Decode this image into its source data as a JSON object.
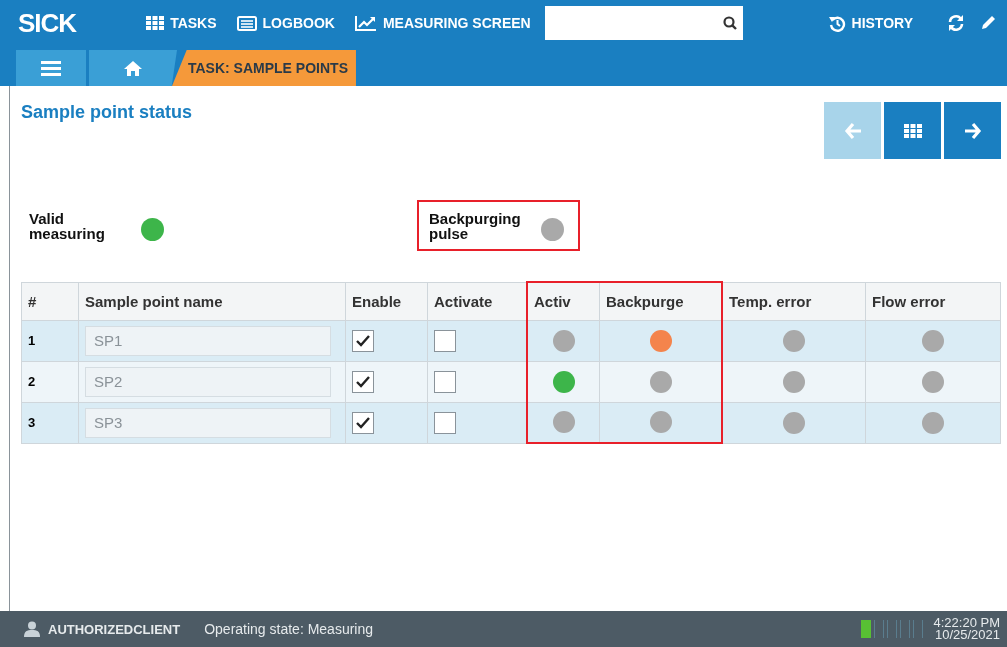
{
  "topbar": {
    "logo": "SICK",
    "nav": [
      {
        "kind": "grid",
        "label": "TASKS"
      },
      {
        "kind": "book",
        "label": "LOGBOOK"
      },
      {
        "kind": "chart",
        "label": "MEASURING SCREEN"
      }
    ],
    "history": "HISTORY"
  },
  "breadcrumb": {
    "task": "TASK: SAMPLE POINTS"
  },
  "page": {
    "title": "Sample point status",
    "pager": [
      {
        "kind": "prev",
        "disabled": true
      },
      {
        "kind": "grid",
        "disabled": false
      },
      {
        "kind": "next",
        "disabled": false
      }
    ]
  },
  "indicators": [
    {
      "label": "Valid measuring",
      "color": "#3db54a",
      "highlighted": false
    },
    {
      "label": "Backpurging pulse",
      "color": "#a9a9a9",
      "highlighted": true
    }
  ],
  "table": {
    "columns": [
      {
        "label": "#",
        "highlighted": false
      },
      {
        "label": "Sample point name",
        "highlighted": false
      },
      {
        "label": "Enable",
        "highlighted": false
      },
      {
        "label": "Activate",
        "highlighted": false
      },
      {
        "label": "Activ",
        "highlighted": true
      },
      {
        "label": "Backpurge",
        "highlighted": true
      },
      {
        "label": "Temp. error",
        "highlighted": false
      },
      {
        "label": "Flow error",
        "highlighted": false
      }
    ],
    "rows": [
      {
        "number": "1",
        "name": "SP1",
        "enable": true,
        "activate": false,
        "statuses": [
          {
            "color": "#a9a9a9"
          },
          {
            "color": "#f4844c"
          },
          {
            "color": "#a9a9a9"
          },
          {
            "color": "#a9a9a9"
          }
        ]
      },
      {
        "number": "2",
        "name": "SP2",
        "enable": true,
        "activate": false,
        "statuses": [
          {
            "color": "#3db54a"
          },
          {
            "color": "#a9a9a9"
          },
          {
            "color": "#a9a9a9"
          },
          {
            "color": "#a9a9a9"
          }
        ]
      },
      {
        "number": "3",
        "name": "SP3",
        "enable": true,
        "activate": false,
        "statuses": [
          {
            "color": "#a9a9a9"
          },
          {
            "color": "#a9a9a9"
          },
          {
            "color": "#a9a9a9"
          },
          {
            "color": "#a9a9a9"
          }
        ]
      }
    ]
  },
  "status_bar": {
    "user": "AUTHORIZEDCLIENT",
    "state": "Operating state: Measuring",
    "signal": {
      "level": 0.2
    },
    "time": "4:22:20 PM",
    "date": "10/25/2021"
  }
}
